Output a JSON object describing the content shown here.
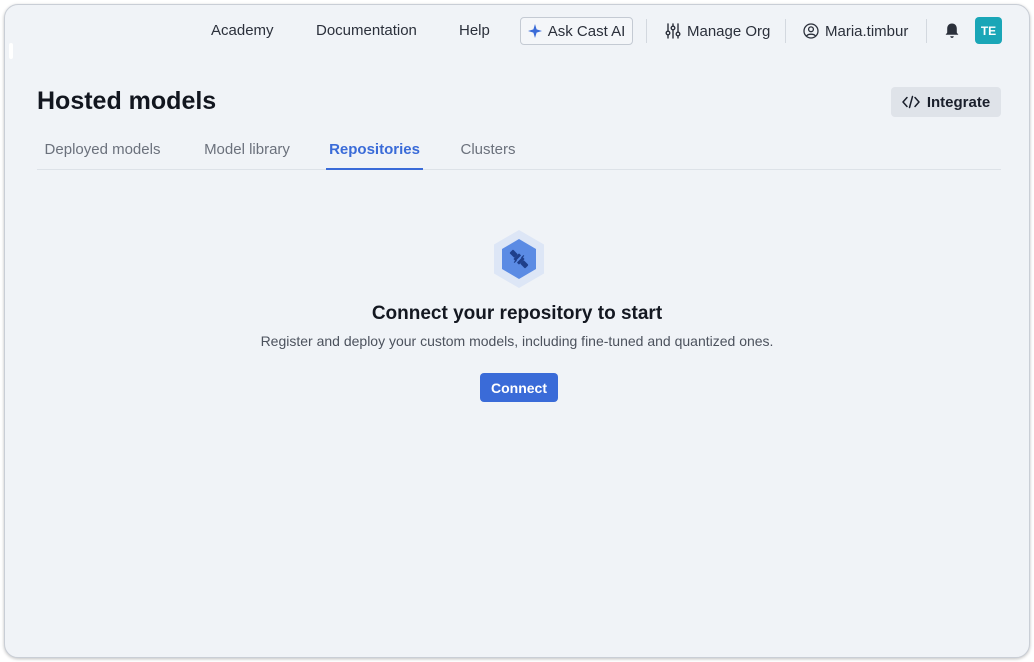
{
  "nav": {
    "academy": "Academy",
    "documentation": "Documentation",
    "help": "Help",
    "ask_ai": "Ask Cast AI",
    "manage_org": "Manage Org",
    "user": "Maria.timbur",
    "avatar_initials": "TE"
  },
  "header": {
    "title": "Hosted models",
    "integrate_label": "Integrate"
  },
  "tabs": [
    {
      "label": "Deployed models",
      "active": false
    },
    {
      "label": "Model library",
      "active": false
    },
    {
      "label": "Repositories",
      "active": true
    },
    {
      "label": "Clusters",
      "active": false
    }
  ],
  "empty_state": {
    "icon": "plug-icon",
    "title": "Connect your repository to start",
    "description": "Register and deploy your custom models, including fine-tuned and quantized ones.",
    "button_label": "Connect"
  },
  "colors": {
    "accent": "#3a6bd8",
    "avatar": "#1aa6b7",
    "background": "#f0f3f7"
  }
}
